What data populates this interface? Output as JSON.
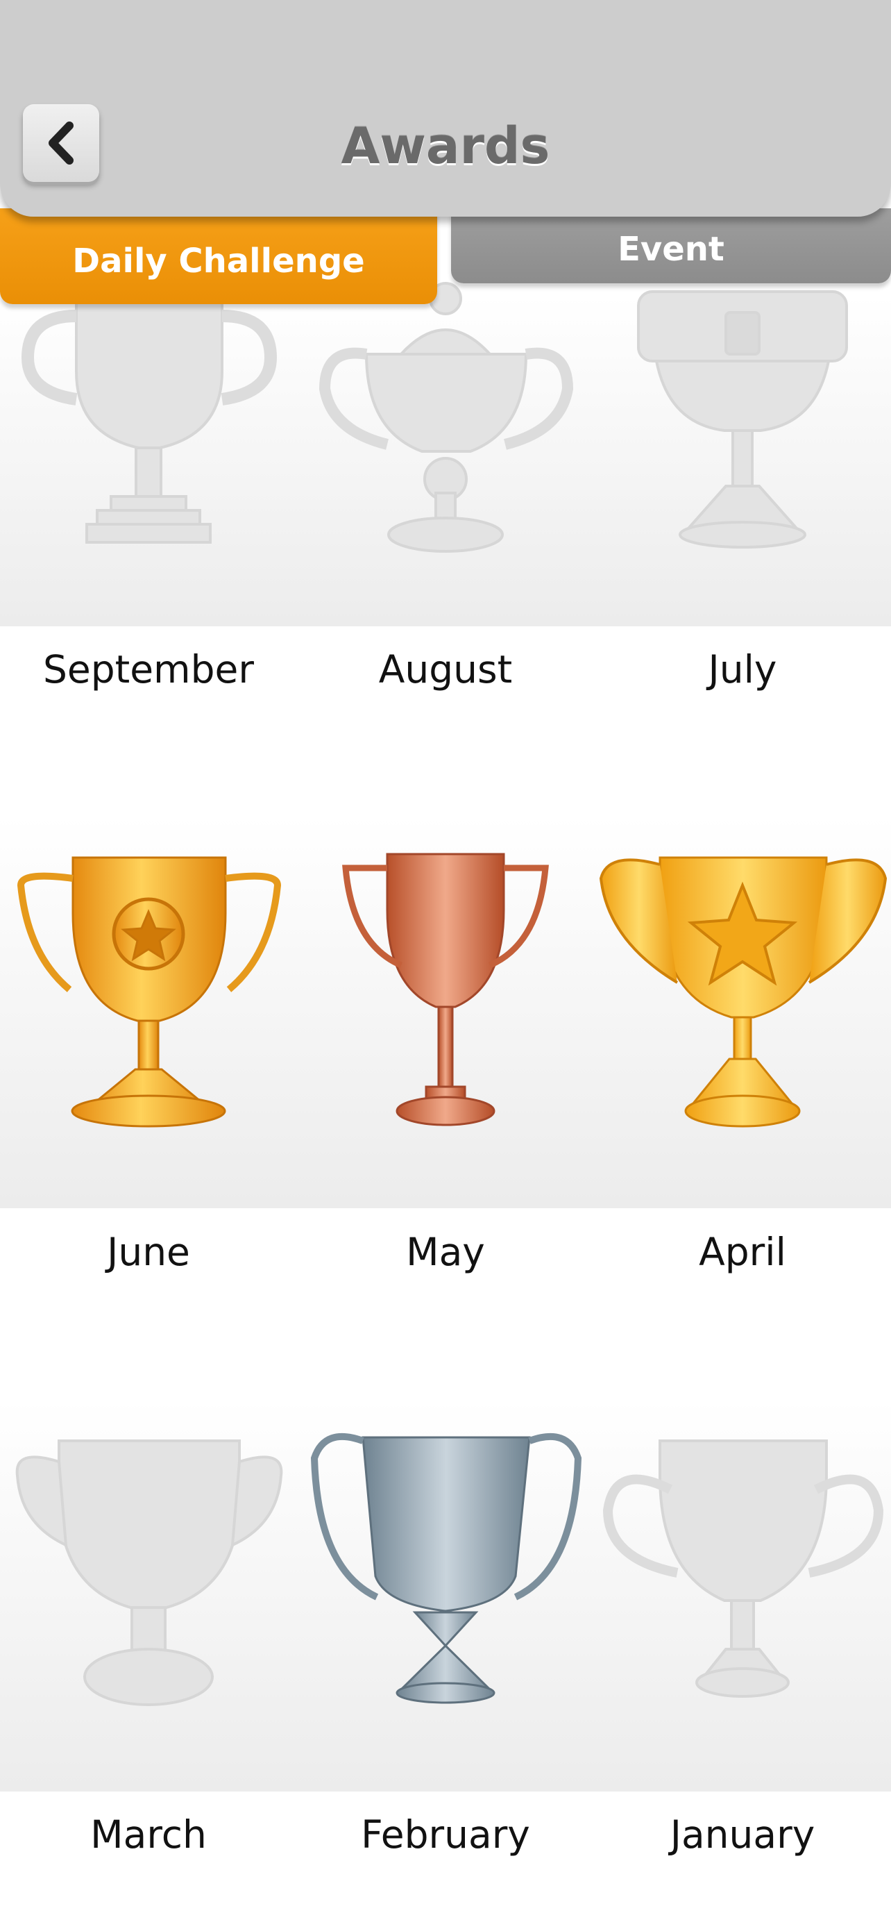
{
  "header": {
    "title": "Awards",
    "back_icon": "chevron-left-icon"
  },
  "tabs": [
    {
      "label": "Daily Challenge",
      "active": true,
      "color": "#f39a10"
    },
    {
      "label": "Event",
      "active": false,
      "color": "#959595"
    }
  ],
  "awards": [
    {
      "month": "September",
      "earned": false,
      "trophy": "two-handle-tiered-cup"
    },
    {
      "month": "August",
      "earned": false,
      "trophy": "lidded-cup"
    },
    {
      "month": "July",
      "earned": false,
      "trophy": "crown-goblet"
    },
    {
      "month": "June",
      "earned": true,
      "trophy": "gold-star-medallion-cup"
    },
    {
      "month": "May",
      "earned": true,
      "trophy": "bronze-cup"
    },
    {
      "month": "April",
      "earned": true,
      "trophy": "gold-star-cup"
    },
    {
      "month": "March",
      "earned": false,
      "trophy": "winged-cup"
    },
    {
      "month": "February",
      "earned": true,
      "trophy": "silver-cup"
    },
    {
      "month": "January",
      "earned": false,
      "trophy": "ornate-loving-cup"
    }
  ]
}
